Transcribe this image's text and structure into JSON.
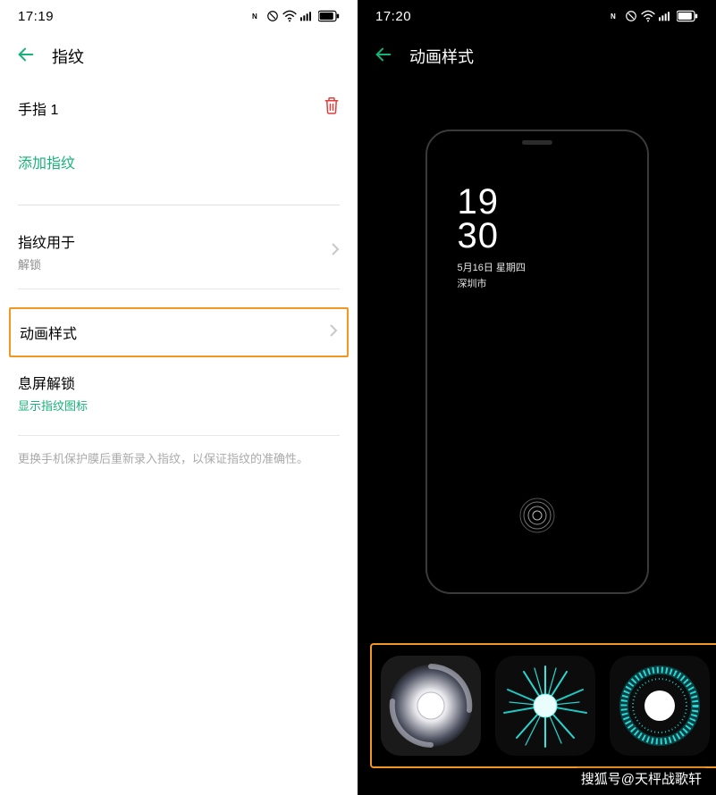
{
  "left": {
    "status_time": "17:19",
    "title": "指纹",
    "finger_label": "手指 1",
    "add_fp": "添加指纹",
    "used_for_label": "指纹用于",
    "used_for_sub": "解锁",
    "anim_style_label": "动画样式",
    "aod_unlock_label": "息屏解锁",
    "aod_unlock_sub": "显示指纹图标",
    "foot_note": "更换手机保护膜后重新录入指纹，以保证指纹的准确性。"
  },
  "right": {
    "status_time": "17:20",
    "title": "动画样式",
    "preview": {
      "time_top": "19",
      "time_bottom": "30",
      "date": "5月16日 星期四",
      "weather": "深圳市"
    },
    "thumbs": [
      "swirl",
      "firework",
      "ring"
    ]
  },
  "watermark": "搜狐号@天枰战歌轩",
  "icons": {
    "back": "back-icon",
    "trash": "trash-icon",
    "chevron": "chevron-right-icon"
  }
}
